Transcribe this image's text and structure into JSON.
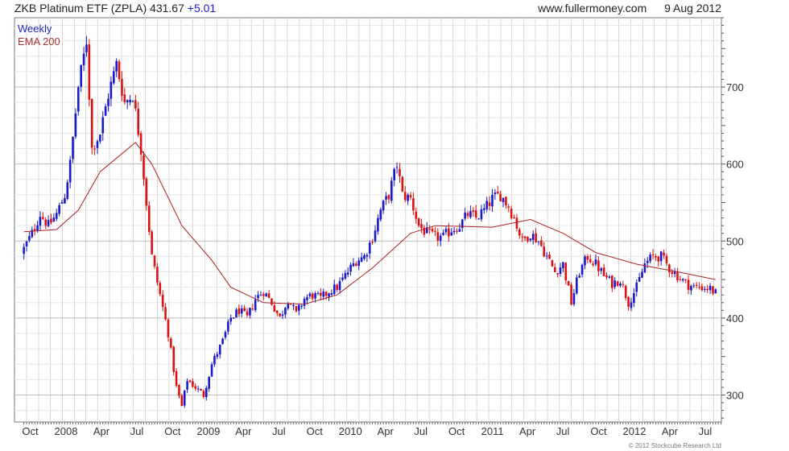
{
  "header": {
    "title": "ZKB Platinum ETF (ZPLA)",
    "last_price": "431.67",
    "change": "+5.01",
    "site": "www.fullermoney.com",
    "date": "9 Aug 2012"
  },
  "footer": {
    "copyright": "© 2012 Stockcube Research Ltd"
  },
  "colors": {
    "up": "#1a1acc",
    "down": "#dd1111",
    "ema": "#aa2222",
    "grid": "#d8d8d8"
  },
  "chart_data": {
    "type": "candlestick",
    "legend": [
      "Weekly",
      "EMA 200"
    ],
    "ylim": [
      265,
      790
    ],
    "yticks": [
      300,
      400,
      500,
      600,
      700
    ],
    "xtick_labels": [
      "Oct",
      "2008",
      "Apr",
      "Jul",
      "Oct",
      "2009",
      "Apr",
      "Jul",
      "Oct",
      "2010",
      "Apr",
      "Jul",
      "Oct",
      "2011",
      "Apr",
      "Jul",
      "Oct",
      "2012",
      "Apr",
      "Jul"
    ],
    "grid": true,
    "series": [
      {
        "name": "Weekly",
        "kind": "ohlc",
        "period": "weekly",
        "anchors": [
          [
            "2007-09-24",
            490
          ],
          [
            "2007-10-15",
            510
          ],
          [
            "2007-11-05",
            535
          ],
          [
            "2007-11-26",
            520
          ],
          [
            "2007-12-17",
            535
          ],
          [
            "2008-01-07",
            560
          ],
          [
            "2008-01-21",
            600
          ],
          [
            "2008-02-11",
            700
          ],
          [
            "2008-03-03",
            760
          ],
          [
            "2008-03-17",
            620
          ],
          [
            "2008-04-07",
            640
          ],
          [
            "2008-04-28",
            690
          ],
          [
            "2008-05-19",
            730
          ],
          [
            "2008-06-09",
            680
          ],
          [
            "2008-06-30",
            690
          ],
          [
            "2008-07-21",
            620
          ],
          [
            "2008-08-04",
            550
          ],
          [
            "2008-08-18",
            480
          ],
          [
            "2008-09-08",
            430
          ],
          [
            "2008-09-29",
            380
          ],
          [
            "2008-10-20",
            310
          ],
          [
            "2008-11-03",
            285
          ],
          [
            "2008-11-17",
            320
          ],
          [
            "2008-12-08",
            310
          ],
          [
            "2008-12-29",
            300
          ],
          [
            "2009-01-19",
            340
          ],
          [
            "2009-02-16",
            370
          ],
          [
            "2009-03-09",
            400
          ],
          [
            "2009-03-30",
            410
          ],
          [
            "2009-04-20",
            400
          ],
          [
            "2009-05-11",
            425
          ],
          [
            "2009-06-01",
            435
          ],
          [
            "2009-06-22",
            420
          ],
          [
            "2009-07-13",
            400
          ],
          [
            "2009-08-03",
            425
          ],
          [
            "2009-08-24",
            405
          ],
          [
            "2009-09-14",
            425
          ],
          [
            "2009-10-05",
            430
          ],
          [
            "2009-10-26",
            425
          ],
          [
            "2009-11-16",
            435
          ],
          [
            "2009-12-07",
            440
          ],
          [
            "2010-01-04",
            460
          ],
          [
            "2010-01-25",
            475
          ],
          [
            "2010-02-15",
            480
          ],
          [
            "2010-03-08",
            505
          ],
          [
            "2010-03-29",
            540
          ],
          [
            "2010-04-19",
            560
          ],
          [
            "2010-05-10",
            600
          ],
          [
            "2010-05-24",
            560
          ],
          [
            "2010-06-14",
            555
          ],
          [
            "2010-07-05",
            520
          ],
          [
            "2010-07-26",
            510
          ],
          [
            "2010-08-16",
            505
          ],
          [
            "2010-09-06",
            505
          ],
          [
            "2010-09-27",
            515
          ],
          [
            "2010-10-18",
            520
          ],
          [
            "2010-11-08",
            535
          ],
          [
            "2010-11-29",
            530
          ],
          [
            "2010-12-20",
            540
          ],
          [
            "2011-01-10",
            555
          ],
          [
            "2011-01-31",
            560
          ],
          [
            "2011-02-21",
            545
          ],
          [
            "2011-03-07",
            530
          ],
          [
            "2011-03-28",
            500
          ],
          [
            "2011-04-18",
            510
          ],
          [
            "2011-05-09",
            500
          ],
          [
            "2011-05-30",
            480
          ],
          [
            "2011-06-20",
            460
          ],
          [
            "2011-07-11",
            470
          ],
          [
            "2011-08-01",
            420
          ],
          [
            "2011-08-22",
            460
          ],
          [
            "2011-09-12",
            480
          ],
          [
            "2011-10-03",
            470
          ],
          [
            "2011-10-24",
            455
          ],
          [
            "2011-11-14",
            445
          ],
          [
            "2011-12-05",
            450
          ],
          [
            "2011-12-26",
            420
          ],
          [
            "2012-01-16",
            440
          ],
          [
            "2012-02-06",
            470
          ],
          [
            "2012-02-27",
            480
          ],
          [
            "2012-03-19",
            480
          ],
          [
            "2012-04-09",
            465
          ],
          [
            "2012-04-30",
            455
          ],
          [
            "2012-05-21",
            445
          ],
          [
            "2012-06-11",
            440
          ],
          [
            "2012-07-02",
            440
          ],
          [
            "2012-07-23",
            438
          ],
          [
            "2012-08-06",
            432
          ]
        ]
      },
      {
        "name": "EMA 200",
        "kind": "line",
        "points": [
          [
            "2007-09-24",
            512
          ],
          [
            "2007-12-17",
            515
          ],
          [
            "2008-02-11",
            540
          ],
          [
            "2008-04-07",
            590
          ],
          [
            "2008-07-07",
            628
          ],
          [
            "2008-08-18",
            600
          ],
          [
            "2008-11-03",
            520
          ],
          [
            "2009-01-19",
            475
          ],
          [
            "2009-03-09",
            440
          ],
          [
            "2009-06-01",
            420
          ],
          [
            "2009-09-14",
            418
          ],
          [
            "2009-12-07",
            430
          ],
          [
            "2010-03-08",
            465
          ],
          [
            "2010-06-14",
            510
          ],
          [
            "2010-08-16",
            520
          ],
          [
            "2011-01-10",
            518
          ],
          [
            "2011-04-18",
            528
          ],
          [
            "2011-07-11",
            510
          ],
          [
            "2011-10-03",
            485
          ],
          [
            "2012-01-16",
            470
          ],
          [
            "2012-04-30",
            460
          ],
          [
            "2012-08-06",
            450
          ]
        ]
      }
    ]
  }
}
